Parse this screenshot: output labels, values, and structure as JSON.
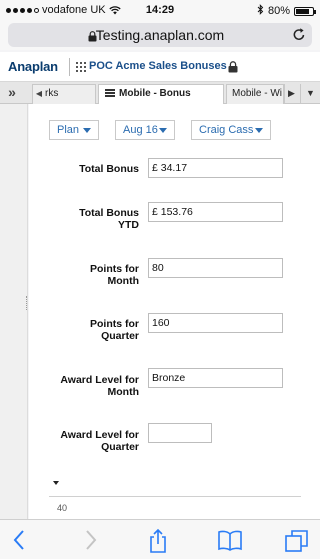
{
  "status_bar": {
    "carrier": "vodafone UK",
    "time": "14:29",
    "battery": "80%",
    "battery_level": 0.8,
    "signal_bars": 4
  },
  "browser": {
    "url": "Testing.anaplan.com"
  },
  "app_header": {
    "logo": "Anaplan",
    "model_name": "POC Acme Sales Bonuses"
  },
  "tabs": {
    "left": "rks",
    "active": "Mobile - Bonus",
    "right": "Mobile - Wi"
  },
  "filters": {
    "plan": "Plan",
    "period": "Aug 16",
    "person": "Craig Cass"
  },
  "form": [
    {
      "label_1": "Total Bonus",
      "label_2": "",
      "value": "£ 34.17"
    },
    {
      "label_1": "Total Bonus",
      "label_2": "YTD",
      "value": "£ 153.76"
    },
    {
      "label_1": "Points for",
      "label_2": "Month",
      "value": "80"
    },
    {
      "label_1": "Points for",
      "label_2": "Quarter",
      "value": "160"
    },
    {
      "label_1": "Award Level for",
      "label_2": "Month",
      "value": "Bronze"
    },
    {
      "label_1": "Award Level for",
      "label_2": "Quarter",
      "value": ""
    }
  ],
  "chart": {
    "tick": "40"
  }
}
